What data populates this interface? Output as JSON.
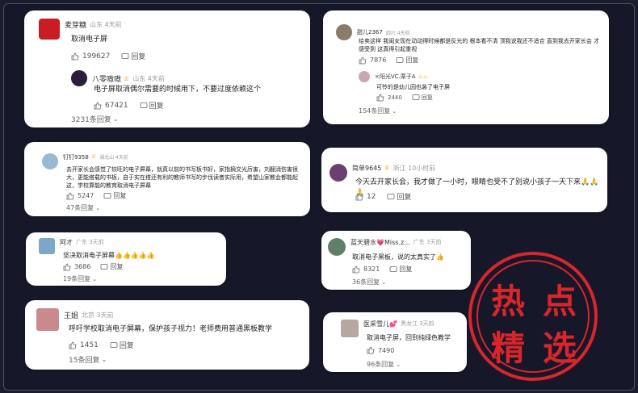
{
  "stamp": {
    "chars": [
      "热",
      "点",
      "精",
      "选"
    ]
  },
  "cards": {
    "c1": {
      "user": "麦芽糖",
      "loc": "山东 4天前",
      "text": "取消电子屏",
      "likes": "199627",
      "reply": "回复",
      "sub": {
        "user": "八零嗷嗷",
        "loc": "山东 4天前",
        "text": "电子屏取消偶尔需要的时候用下，不要过度依赖这个",
        "likes": "67421",
        "reply": "回复"
      },
      "reply_count": "3231条回复"
    },
    "c2": {
      "user": "甜儿2367",
      "loc": "四川 4天前",
      "text": "给卖这样 我闺女现在动动得时候都是反光的 根本看不清 顶我说我还不适合 直到我去开家长会 才感受到 这真得引起重视",
      "likes": "7876",
      "reply": "回复",
      "sub": {
        "user": "×阳光VC.栗子A",
        "text": "可怜的是幼儿园也装了电子屏",
        "likes": "2440",
        "reply": "回复"
      },
      "reply_count": "154条回复"
    },
    "c3": {
      "user": "钉钉9358",
      "loc": "湖北山 4天前",
      "text": "去开家长会感觉了较旺的电子屏幕，就真以前的书写板书好，家指摘交光厉害，刘翻消伤害很大，更能搭载的书板，自于实在搭还有利的教师书写的步伐读者实际用，希望山家教会都能起这，学校算能的教育取消电子屏幕",
      "likes": "5247",
      "reply": "回复",
      "reply_count": "47条回复"
    },
    "c4": {
      "user": "简单9645",
      "loc": "浙江 10小时前",
      "text": "今天去开家长会，我才做了一小时，眼睛也受不了别说小孩子一天下来🙏🙏🙏",
      "likes": "12",
      "reply": "回复"
    },
    "c5": {
      "user": "阿才",
      "loc": "广东 3天前",
      "text": "坚决取消电子屏幕👍👍👍👍👍",
      "likes": "3686",
      "reply": "回复",
      "reply_count": "19条回复"
    },
    "c6": {
      "user": "蓝天碧水💗Miss.z...",
      "loc": "广东 3天前",
      "text": "取消电子黑板，说的太真实了👍",
      "likes": "8321",
      "reply": "回复",
      "reply_count": "36条回复"
    },
    "c7": {
      "user": "王姐",
      "loc": "北京 3天前",
      "text": "呼吁学校取消电子屏幕，保护孩子视力！老师费用普通黑板教学",
      "likes": "1451",
      "reply": "回复",
      "reply_count": "15条回复"
    },
    "c8": {
      "user": "医采雪儿💕",
      "loc": "黑龙江 3天前",
      "text": "取消电子屏，回到纯绿色教学",
      "likes": "7490",
      "reply": "回复",
      "reply_count": "96条回复"
    }
  },
  "colors": {
    "stamp": "#d9252b",
    "badge": "#e5a100"
  }
}
